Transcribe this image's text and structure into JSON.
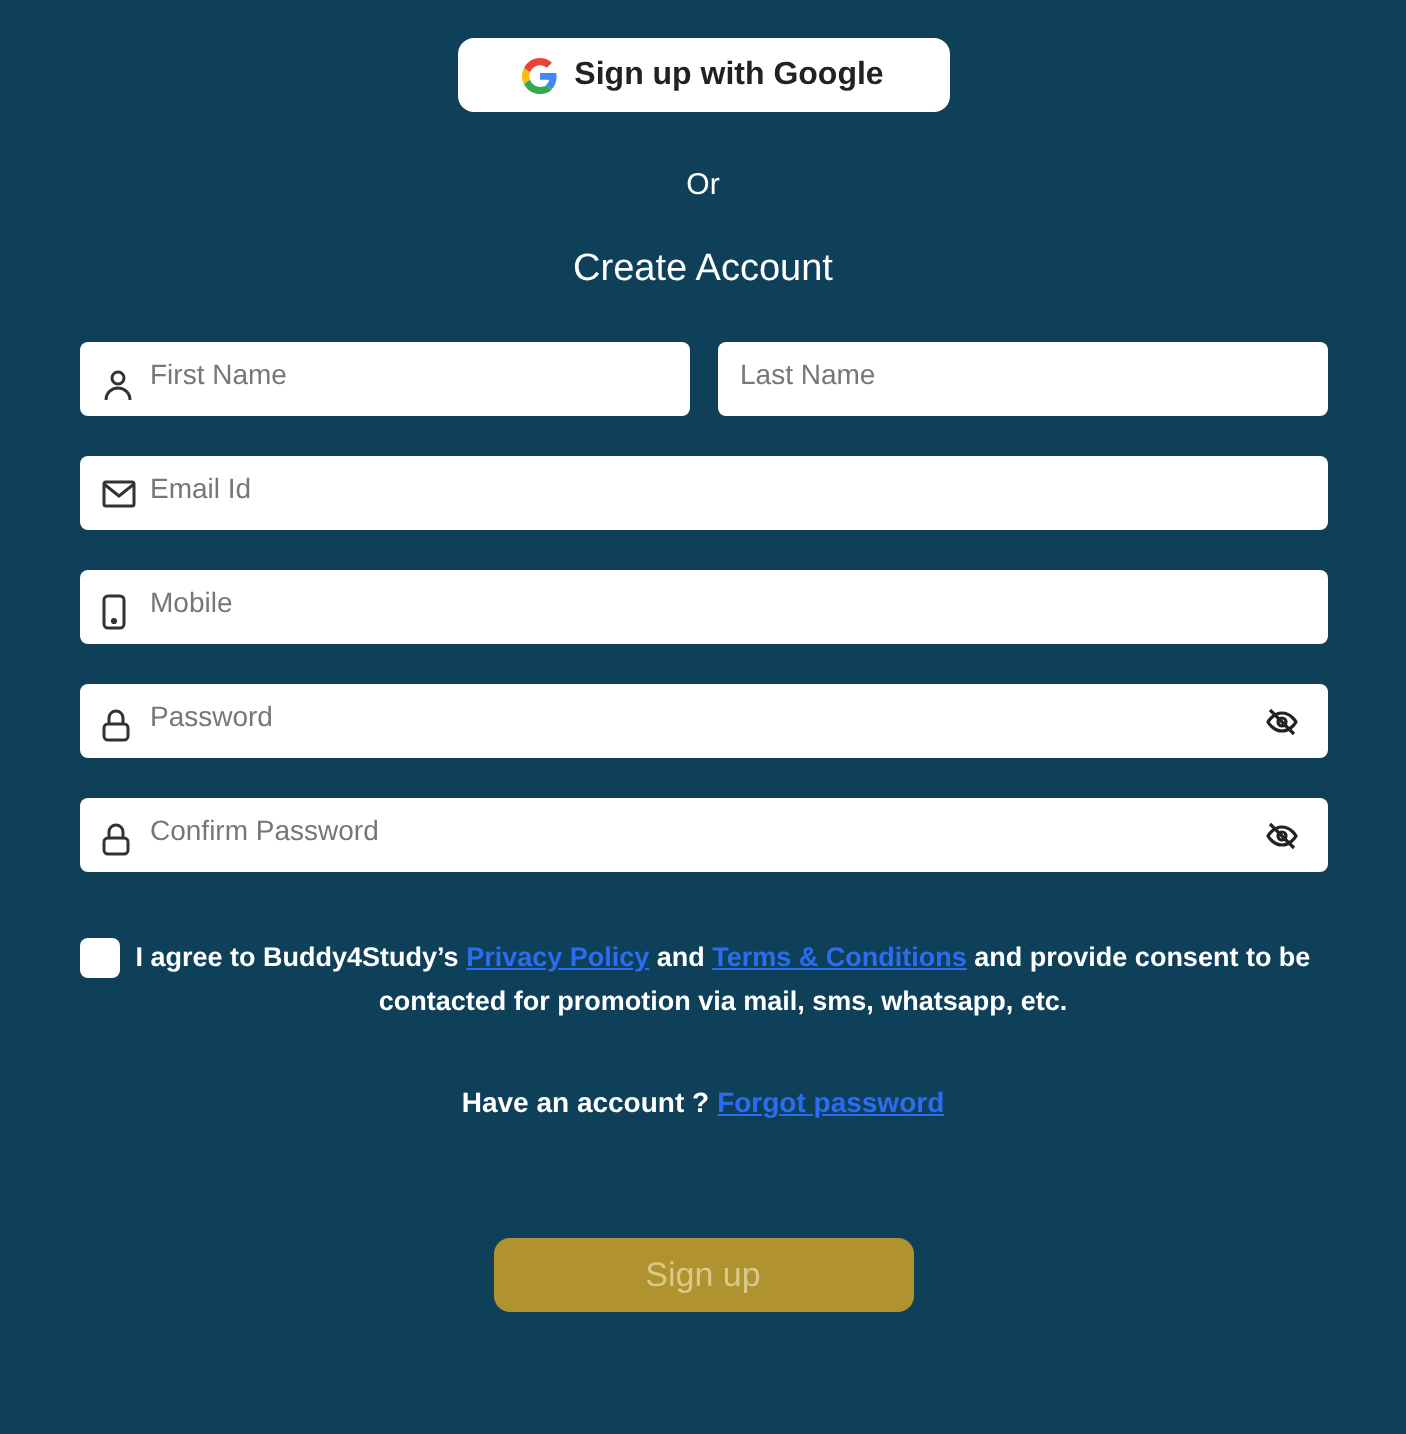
{
  "google_button": {
    "label": "Sign up with Google"
  },
  "divider_text": "Or",
  "heading": "Create Account",
  "fields": [
    {
      "placeholder": "First Name",
      "kind": "person",
      "half": true
    },
    {
      "placeholder": "Last Name",
      "kind": "none",
      "half": true
    },
    {
      "placeholder": "Email Id",
      "kind": "mail",
      "half": false
    },
    {
      "placeholder": "Mobile",
      "kind": "phone",
      "half": false
    },
    {
      "placeholder": "Password",
      "kind": "password",
      "half": false
    },
    {
      "placeholder": "Confirm Password",
      "kind": "password",
      "half": false
    }
  ],
  "consent": {
    "checked": false,
    "parts": [
      {
        "kind": "text",
        "text": "I agree to Buddy4Study’s "
      },
      {
        "kind": "link",
        "text": "Privacy Policy"
      },
      {
        "kind": "text",
        "text": " and "
      },
      {
        "kind": "link",
        "text": "Terms & Conditions"
      },
      {
        "kind": "text",
        "text": " and provide consent to be contacted for promotion via mail, sms, whatsapp, etc."
      }
    ]
  },
  "account_prompt": {
    "text": "Have an account ?",
    "link": "Forgot password"
  },
  "signup_button": {
    "label": "Sign up",
    "disabled": true
  }
}
